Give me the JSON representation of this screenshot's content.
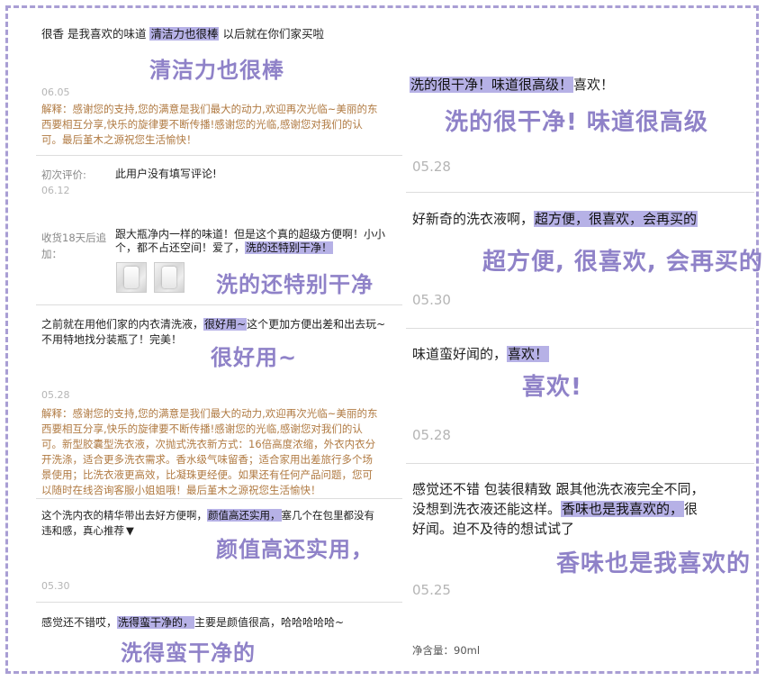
{
  "left": {
    "r1": {
      "text_before": "很香 是我喜欢的味道 ",
      "highlight": "清洁力也很棒",
      "text_after": " 以后就在你们家买啦",
      "caption": "清洁力也很棒",
      "date": "06.05",
      "reply_lines": [
        "解释：感谢您的支持,您的满意是我们最大的动力,欢迎再次光临~美丽的东",
        "西要相互分享,快乐的旋律要不断传播!感谢您的光临,感谢您对我们的认",
        "可。最后堇木之源祝您生活愉快！"
      ]
    },
    "r2": {
      "first_label": "初次评价:",
      "first_text": "此用户没有填写评论!",
      "date": "06.12",
      "append_label_1": "收货18天后追",
      "append_label_2": "加：",
      "line1": "跟大瓶净内一样的味道！但是这个真的超级方便啊！小小",
      "line2_before": "个，都不占还空间！爱了，",
      "highlight": "洗的还特别干净！",
      "caption": "洗的还特别干净"
    },
    "r3": {
      "line1_before": "之前就在用他们家的内衣清洗液，",
      "highlight": "很好用~",
      "line1_after": "这个更加方便出差和出去玩~",
      "line2": "不用特地找分装瓶了！完美！",
      "caption": "很好用~",
      "date": "05.28",
      "reply_lines": [
        "解释：感谢您的支持,您的满意是我们最大的动力,欢迎再次光临~美丽的东",
        "西要相互分享,快乐的旋律要不断传播!感谢您的光临,感谢您对我们的认",
        "可。新型胶囊型洗衣液，次抛式洗衣新方式：16倍高度浓缩，外衣内衣分",
        "开洗涤，适合更多洗衣需求。香水级气味留香；适合家用出差旅行多个场",
        "景使用；比洗衣液更高效，比凝珠更经便。如果还有任何产品问题，您可",
        "以随时在线咨询客服小姐姐哦！最后堇木之源祝您生活愉快！"
      ]
    },
    "r4": {
      "line1_before": "这个洗内衣的精华带出去好方便啊，",
      "highlight": "颜值高还实用，",
      "line1_after": "塞几个在包里都没有",
      "line2": "违和感，真心推荐",
      "caption": "颜值高还实用，",
      "date": "05.30"
    },
    "r5": {
      "text_before": "感觉还不错哎，",
      "highlight": "洗得蛮干净的，",
      "text_after": "主要是颜值很高，哈哈哈哈哈~",
      "caption": "洗得蛮干净的"
    }
  },
  "right": {
    "r1": {
      "highlight": "洗的很干净！味道很高级！",
      "text_after": "喜欢！",
      "caption": "洗的很干净! 味道很高级",
      "date": "05.28"
    },
    "r2": {
      "text_before": "好新奇的洗衣液啊，",
      "highlight": "超方便，很喜欢，会再买的",
      "caption": "超方便, 很喜欢, 会再买的",
      "date": "05.30"
    },
    "r3": {
      "text_before": "味道蛮好闻的，",
      "highlight": "喜欢！",
      "caption": "喜欢!",
      "date": "05.28"
    },
    "r4": {
      "line1": "感觉还不错 包装很精致 跟其他洗衣液完全不同，",
      "line2_before": "没想到洗衣液还能这样。",
      "highlight": "香味也是我喜欢的，",
      "line2_after": "很",
      "line3": "好闻。迫不及待的想试试了",
      "caption": "香味也是我喜欢的",
      "date": "05.25",
      "spec": "净含量：90ml"
    }
  }
}
